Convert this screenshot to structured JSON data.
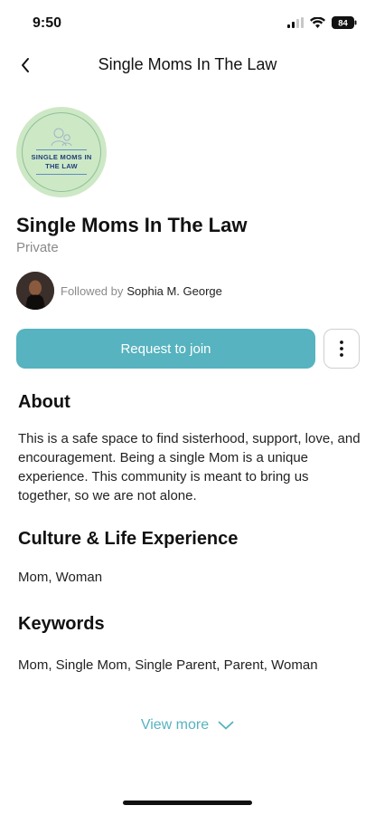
{
  "status_bar": {
    "time": "9:50",
    "battery": "84"
  },
  "header": {
    "title": "Single Moms In The Law"
  },
  "group": {
    "logo_text": "SINGLE MOMS IN THE LAW",
    "name": "Single Moms In The Law",
    "privacy": "Private",
    "followed_by_label": "Followed by",
    "followed_by_name": "Sophia M. George"
  },
  "actions": {
    "join_label": "Request to join"
  },
  "about": {
    "heading": "About",
    "text": "This is a safe space to find sisterhood, support, love, and encouragement. Being a single Mom is a unique experience. This community is meant to bring us together, so we are not alone."
  },
  "culture": {
    "heading": "Culture & Life Experience",
    "text": "Mom, Woman"
  },
  "keywords": {
    "heading": "Keywords",
    "text": "Mom, Single Mom, Single Parent, Parent, Woman"
  },
  "view_more_label": "View more",
  "colors": {
    "accent": "#56b3bf",
    "logo_bg": "#cde8c5",
    "muted_text": "#8a8a8a"
  }
}
